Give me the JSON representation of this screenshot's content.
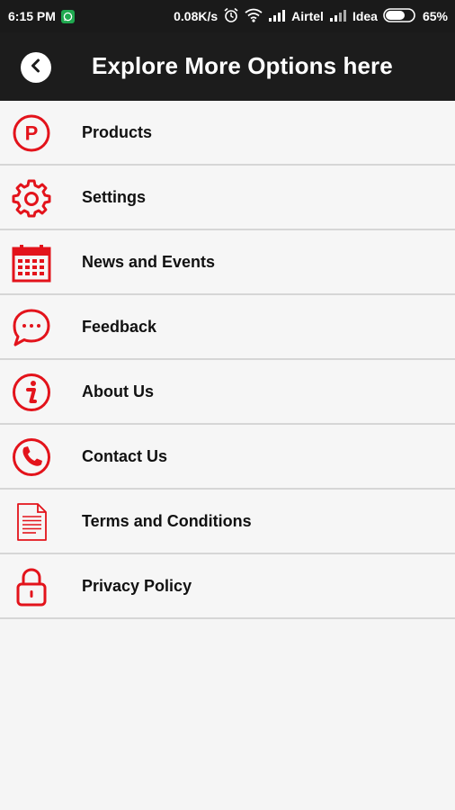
{
  "status_bar": {
    "time": "6:15 PM",
    "net_speed": "0.08K/s",
    "carrier1": "Airtel",
    "carrier2": "Idea",
    "battery": "65%",
    "icons": [
      "whatsapp-icon",
      "alarm-icon",
      "wifi-icon",
      "signal-icon",
      "signal-icon",
      "battery-icon"
    ]
  },
  "header": {
    "title": "Explore More Options here",
    "back_icon": "back-arrow-icon"
  },
  "menu": {
    "items": [
      {
        "label": "Products",
        "icon": "products-p-icon"
      },
      {
        "label": "Settings",
        "icon": "gear-icon"
      },
      {
        "label": "News and Events",
        "icon": "calendar-icon"
      },
      {
        "label": "Feedback",
        "icon": "chat-bubble-icon"
      },
      {
        "label": "About Us",
        "icon": "info-icon"
      },
      {
        "label": "Contact Us",
        "icon": "phone-icon"
      },
      {
        "label": "Terms and Conditions",
        "icon": "document-icon"
      },
      {
        "label": "Privacy Policy",
        "icon": "lock-icon"
      }
    ]
  },
  "colors": {
    "accent": "#e3131b",
    "header_bg": "#1c1c1c",
    "list_bg": "#f6f6f6",
    "divider": "#d6d6d6"
  }
}
